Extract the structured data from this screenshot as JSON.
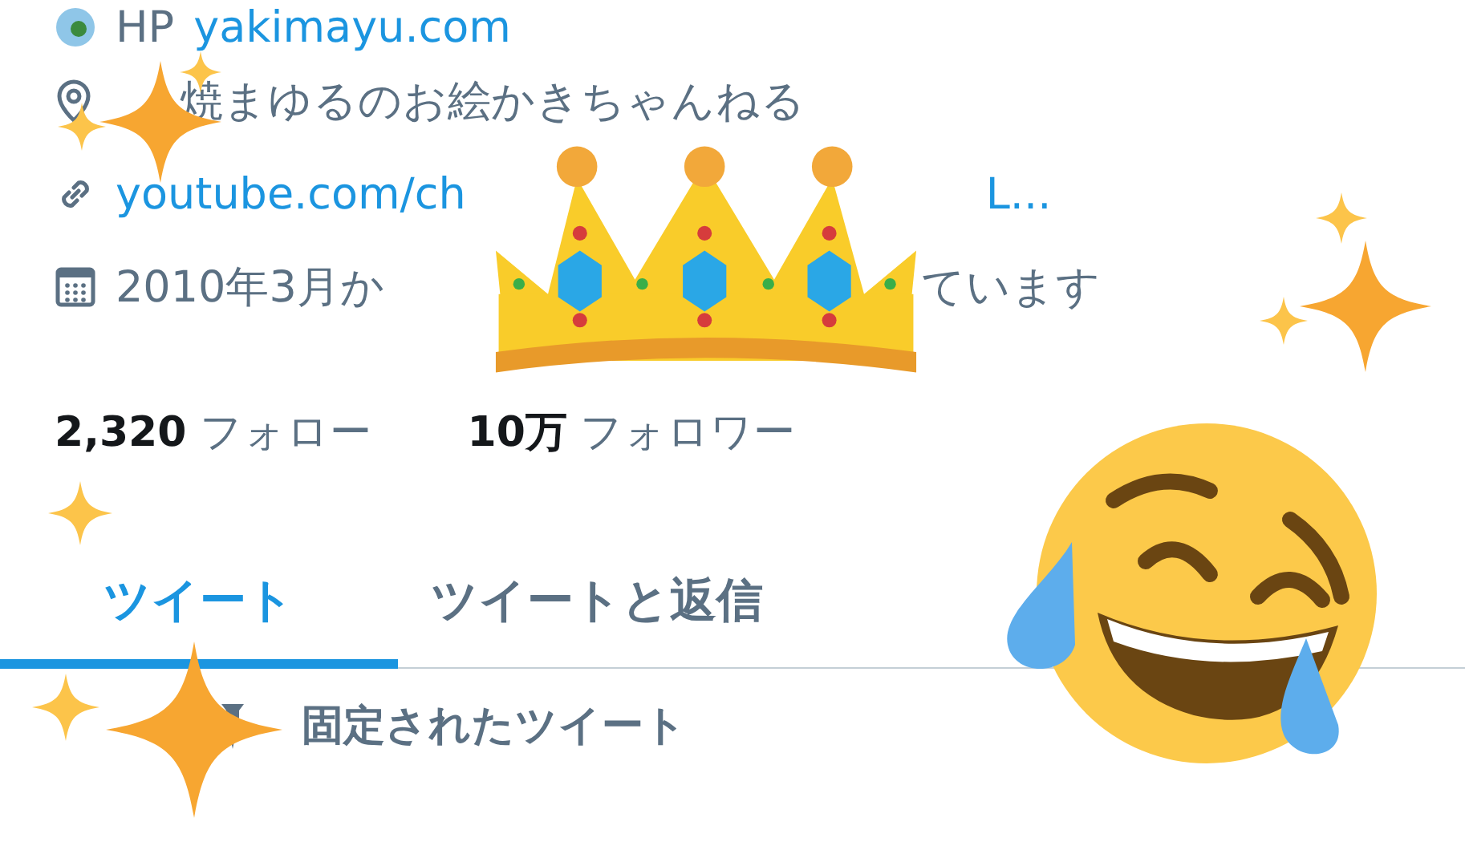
{
  "website": {
    "label": "HP",
    "url": "yakimayu.com"
  },
  "location": "焼まゆるのお絵かきちゃんねる",
  "link": {
    "start": "youtube.com/ch",
    "end": "L..."
  },
  "joined": {
    "start": "2010年3月か",
    "end": "ています"
  },
  "counts": [
    {
      "value": "2,320",
      "label": "フォロー"
    },
    {
      "value": "10万",
      "label": "フォロワー"
    }
  ],
  "tabs": [
    {
      "label": "ツイート",
      "selected": true
    },
    {
      "label": "ツイートと返信",
      "selected": false
    }
  ],
  "pinned": "固定されたツイート"
}
